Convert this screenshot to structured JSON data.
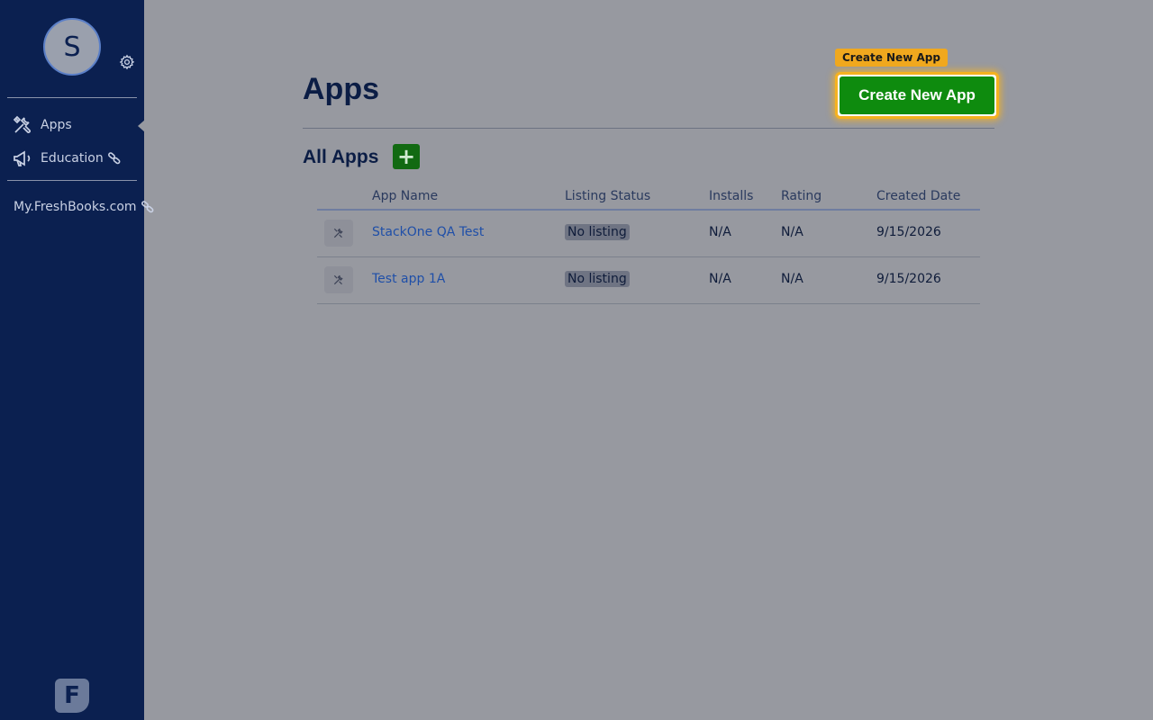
{
  "sidebar": {
    "avatar_initial": "S",
    "nav": [
      {
        "label": "Apps",
        "icon": "tools-icon",
        "active": true
      },
      {
        "label": "Education",
        "icon": "megaphone-icon",
        "external": true
      }
    ],
    "external_link": "My.FreshBooks.com",
    "brand_letter": "F"
  },
  "header": {
    "title": "Apps",
    "create_tooltip": "Create New App",
    "create_button": "Create New App"
  },
  "section": {
    "title": "All Apps",
    "add_label": "+"
  },
  "table": {
    "columns": [
      "App Name",
      "Listing Status",
      "Installs",
      "Rating",
      "Created Date"
    ],
    "rows": [
      {
        "name": "StackOne QA Test",
        "status": "No listing",
        "installs": "N/A",
        "rating": "N/A",
        "created": "9/15/2026"
      },
      {
        "name": "Test app 1A",
        "status": "No listing",
        "installs": "N/A",
        "rating": "N/A",
        "created": "9/15/2026"
      }
    ]
  },
  "colors": {
    "sidebar_bg": "#0b2050",
    "page_bg": "#9799a0",
    "primary_green": "#0e8b0e",
    "highlight_orange": "#f0a81e",
    "link_blue": "#1f4fa8"
  }
}
